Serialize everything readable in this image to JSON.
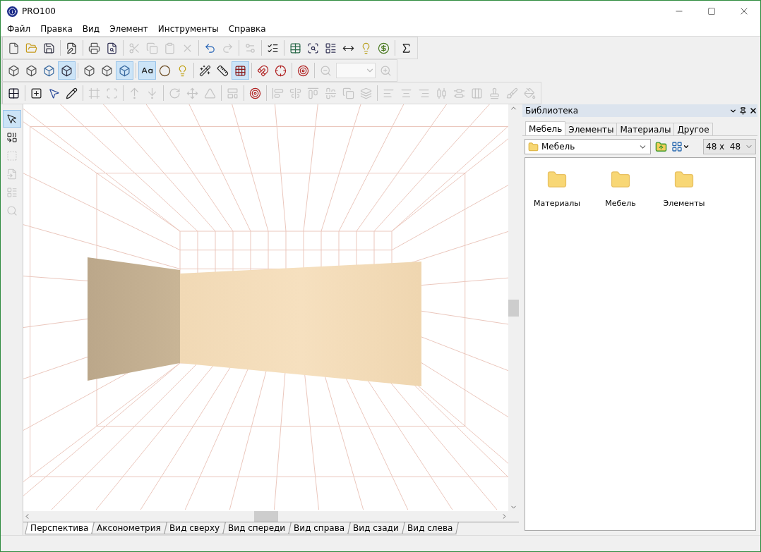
{
  "window": {
    "title": "PRO100"
  },
  "menu": [
    {
      "label": "Файл"
    },
    {
      "label": "Правка"
    },
    {
      "label": "Вид"
    },
    {
      "label": "Элемент"
    },
    {
      "label": "Инструменты"
    },
    {
      "label": "Справка"
    }
  ],
  "toolbars": [
    [
      [
        {
          "disabled": false
        },
        {
          "disabled": false
        },
        {
          "disabled": false
        }
      ],
      [
        {
          "disabled": false
        }
      ],
      [
        {
          "disabled": false
        },
        {
          "disabled": false
        }
      ],
      [
        {
          "disabled": true
        },
        {
          "disabled": true
        },
        {
          "disabled": true
        },
        {
          "disabled": true
        }
      ],
      [
        {
          "disabled": false
        },
        {
          "disabled": true
        }
      ],
      [
        {
          "disabled": true
        }
      ],
      [
        {
          "disabled": false
        }
      ],
      [
        {
          "disabled": false
        },
        {
          "disabled": false
        },
        {
          "disabled": false
        },
        {
          "disabled": false
        },
        {
          "disabled": false
        },
        {
          "disabled": false
        }
      ],
      [
        {
          "disabled": false
        }
      ]
    ],
    [
      [
        {
          "kind": "button",
          "selected": false,
          "disabled": false
        },
        {
          "kind": "button",
          "selected": false,
          "disabled": false
        },
        {
          "kind": "button",
          "selected": false,
          "disabled": false
        },
        {
          "kind": "button",
          "selected": true,
          "disabled": false
        }
      ],
      [
        {
          "kind": "button",
          "selected": false,
          "disabled": false
        },
        {
          "kind": "button",
          "selected": false,
          "disabled": false
        },
        {
          "kind": "button",
          "selected": true,
          "disabled": false
        }
      ],
      [
        {
          "kind": "button",
          "selected": true,
          "disabled": false
        },
        {
          "kind": "button",
          "selected": false,
          "disabled": false
        },
        {
          "kind": "button",
          "selected": false,
          "disabled": false
        }
      ],
      [
        {
          "kind": "button",
          "selected": false,
          "disabled": false
        },
        {
          "kind": "button",
          "selected": false,
          "disabled": false
        },
        {
          "kind": "button",
          "selected": true,
          "disabled": false
        }
      ],
      [
        {
          "kind": "button",
          "selected": false,
          "disabled": false
        },
        {
          "kind": "button",
          "selected": false,
          "disabled": false
        }
      ],
      [
        {
          "kind": "button",
          "selected": false,
          "disabled": false
        }
      ],
      [
        {
          "kind": "button",
          "selected": false,
          "disabled": true
        },
        {
          "kind": "combo",
          "disabled": true
        },
        {
          "kind": "button",
          "selected": false,
          "disabled": true
        }
      ]
    ],
    [
      [
        {
          "disabled": false
        }
      ],
      [
        {
          "disabled": false
        },
        {
          "disabled": false
        },
        {
          "disabled": false
        }
      ],
      [
        {
          "disabled": true
        },
        {
          "disabled": true
        }
      ],
      [
        {
          "disabled": true
        },
        {
          "disabled": true
        }
      ],
      [
        {
          "disabled": true
        },
        {
          "disabled": true
        },
        {
          "disabled": true
        }
      ],
      [
        {
          "disabled": true
        }
      ],
      [
        {
          "disabled": false
        }
      ],
      [
        {
          "disabled": true
        },
        {
          "disabled": true
        },
        {
          "disabled": true
        },
        {
          "disabled": true
        },
        {
          "disabled": true
        },
        {
          "disabled": true
        }
      ],
      [
        {
          "disabled": true
        },
        {
          "disabled": true
        },
        {
          "disabled": true
        },
        {
          "disabled": true
        },
        {
          "disabled": true
        },
        {
          "disabled": true
        },
        {
          "disabled": true
        },
        {
          "disabled": true
        },
        {
          "disabled": true
        }
      ]
    ]
  ],
  "side_tools": [
    {
      "selected": true,
      "disabled": false
    },
    {
      "selected": false,
      "disabled": false
    },
    {
      "selected": false,
      "disabled": true
    },
    {
      "selected": false,
      "disabled": true
    },
    {
      "selected": false,
      "disabled": true
    },
    {
      "selected": false,
      "disabled": true
    }
  ],
  "view_tabs": [
    {
      "label": "Перспектива",
      "selected": true
    },
    {
      "label": "Аксонометрия",
      "selected": false
    },
    {
      "label": "Вид сверху",
      "selected": false
    },
    {
      "label": "Вид спереди",
      "selected": false
    },
    {
      "label": "Вид справа",
      "selected": false
    },
    {
      "label": "Вид сзади",
      "selected": false
    },
    {
      "label": "Вид слева",
      "selected": false
    }
  ],
  "library": {
    "title": "Библиотека",
    "tabs": [
      {
        "label": "Мебель",
        "selected": true
      },
      {
        "label": "Элементы",
        "selected": false
      },
      {
        "label": "Материалы",
        "selected": false
      },
      {
        "label": "Другое",
        "selected": false
      }
    ],
    "folder": "Мебель",
    "size": "48 x  48",
    "items": [
      {
        "label": "Материалы"
      },
      {
        "label": "Мебель"
      },
      {
        "label": "Элементы"
      }
    ]
  }
}
